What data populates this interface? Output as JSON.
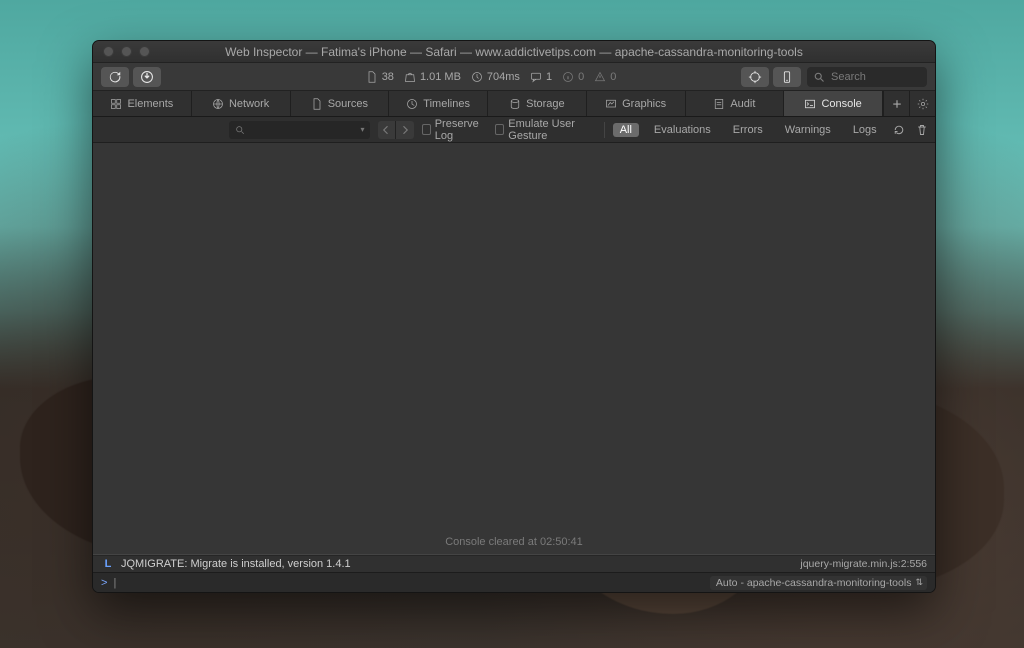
{
  "window": {
    "title": "Web Inspector — Fatima's iPhone — Safari — www.addictivetips.com — apache-cassandra-monitoring-tools"
  },
  "toolbar": {
    "stats": {
      "resources": "38",
      "size": "1.01 MB",
      "time": "704ms",
      "messages": "1",
      "info": "0",
      "warnings": "0"
    },
    "search_placeholder": "Search"
  },
  "tabs": [
    {
      "icon": "elements",
      "label": "Elements"
    },
    {
      "icon": "network",
      "label": "Network"
    },
    {
      "icon": "sources",
      "label": "Sources"
    },
    {
      "icon": "timelines",
      "label": "Timelines"
    },
    {
      "icon": "storage",
      "label": "Storage"
    },
    {
      "icon": "graphics",
      "label": "Graphics"
    },
    {
      "icon": "audit",
      "label": "Audit"
    },
    {
      "icon": "console",
      "label": "Console"
    }
  ],
  "active_tab": "Console",
  "filterbar": {
    "preserve_log": "Preserve Log",
    "emulate_gesture": "Emulate User Gesture",
    "filters": {
      "all": "All",
      "evaluations": "Evaluations",
      "errors": "Errors",
      "warnings": "Warnings",
      "logs": "Logs"
    },
    "active_filter": "All"
  },
  "console": {
    "cleared_message": "Console cleared at 02:50:41",
    "log": {
      "level_icon": "L",
      "message": "JQMIGRATE: Migrate is installed, version 1.4.1",
      "source": "jquery-migrate.min.js:2:556"
    }
  },
  "prompt": {
    "context": "Auto - apache-cassandra-monitoring-tools"
  }
}
